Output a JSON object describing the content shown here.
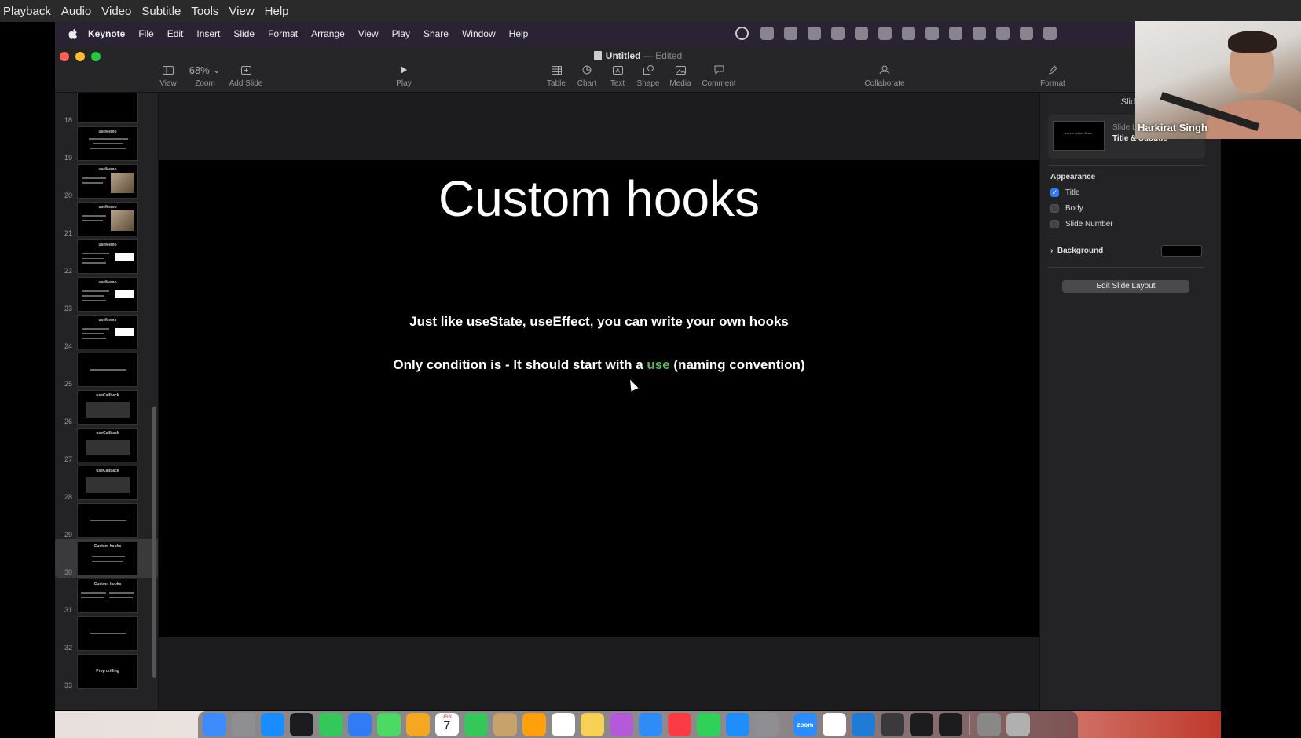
{
  "player_menu": [
    "Playback",
    "Audio",
    "Video",
    "Subtitle",
    "Tools",
    "View",
    "Help"
  ],
  "mac_menu": {
    "app": "Keynote",
    "items": [
      "File",
      "Edit",
      "Insert",
      "Slide",
      "Format",
      "Arrange",
      "View",
      "Play",
      "Share",
      "Window",
      "Help"
    ]
  },
  "window": {
    "title": "Untitled",
    "separator": "—",
    "status": "Edited"
  },
  "toolbar": {
    "view": "View",
    "zoom_value": "68%",
    "zoom": "Zoom",
    "add_slide": "Add Slide",
    "play": "Play",
    "table": "Table",
    "chart": "Chart",
    "text": "Text",
    "shape": "Shape",
    "media": "Media",
    "comment": "Comment",
    "collaborate": "Collaborate",
    "format": "Format"
  },
  "navigator": {
    "slides": [
      {
        "num": "18",
        "title": ""
      },
      {
        "num": "19",
        "title": "useMemo"
      },
      {
        "num": "20",
        "title": "useMemo"
      },
      {
        "num": "21",
        "title": "useMemo"
      },
      {
        "num": "22",
        "title": "useMemo"
      },
      {
        "num": "23",
        "title": "useMemo"
      },
      {
        "num": "24",
        "title": "useMemo"
      },
      {
        "num": "25",
        "title": ""
      },
      {
        "num": "26",
        "title": "useCallback"
      },
      {
        "num": "27",
        "title": "useCallback"
      },
      {
        "num": "28",
        "title": "useCallback"
      },
      {
        "num": "29",
        "title": ""
      },
      {
        "num": "30",
        "title": "Custom hooks"
      },
      {
        "num": "31",
        "title": "Custom hooks"
      },
      {
        "num": "32",
        "title": ""
      },
      {
        "num": "33",
        "title": "Prop drilling"
      }
    ],
    "selected": "30"
  },
  "slide": {
    "title": "Custom hooks",
    "body_line1": "Just like useState, useEffect, you can write your own hooks",
    "body_line2_pre": "Only condition is - It should start with a ",
    "body_line2_highlight": "use",
    "body_line2_post": " (naming convention)",
    "highlight_color": "#5cb85c"
  },
  "inspector": {
    "tab": "Slide",
    "layout_sub": "Slide Layout",
    "layout_name": "Title & Subtitle",
    "appearance": "Appearance",
    "options": [
      {
        "label": "Title",
        "checked": true
      },
      {
        "label": "Body",
        "checked": false
      },
      {
        "label": "Slide Number",
        "checked": false
      }
    ],
    "background": "Background",
    "edit_layout": "Edit Slide Layout"
  },
  "webcam": {
    "name": "Harkirat Singh"
  },
  "dock": {
    "icons": [
      "finder-icon",
      "launchpad-icon",
      "safari-icon",
      "tv-icon",
      "messages-icon",
      "mail-icon",
      "maps-icon",
      "photos-icon",
      "calendar-icon",
      "facetime-icon",
      "notes-icon",
      "pages-icon",
      "reminders-icon",
      "notes-yellow-icon",
      "podcasts-icon",
      "keynote-icon",
      "music-icon",
      "numbers-icon",
      "app-store-icon",
      "system-settings-icon",
      "zoom-icon",
      "chrome-icon",
      "vscode-icon",
      "activity-icon",
      "terminal-icon",
      "terminal-2-icon",
      "preview-icon",
      "trash-icon"
    ],
    "calendar_month": "JAN",
    "calendar_day": "7",
    "zoom_label": "zoom"
  }
}
